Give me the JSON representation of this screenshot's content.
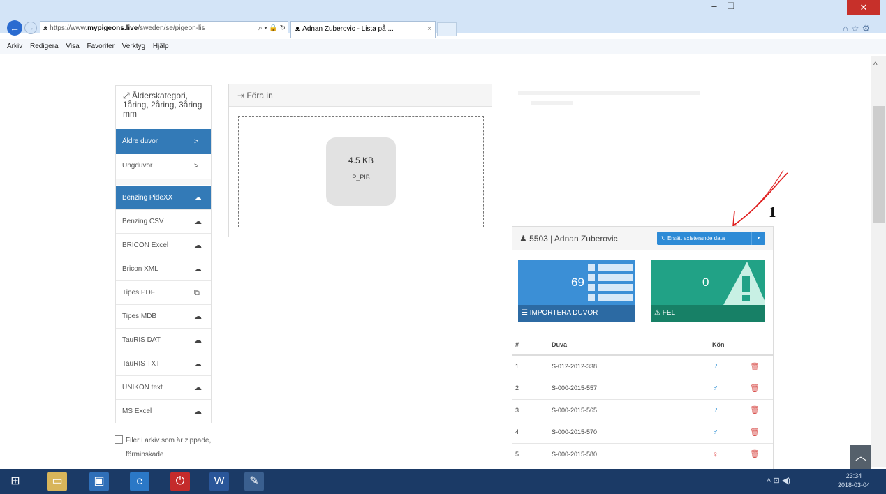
{
  "browser": {
    "url": "https://www.mypigeons.live/sweden/se/pigeon-lis",
    "url_prefix": "https://www.",
    "url_host": "mypigeons.live",
    "url_path": "/sweden/se/pigeon-lis",
    "tab_title": "Adnan Zuberovic - Lista på ...",
    "menu": [
      "Arkiv",
      "Redigera",
      "Visa",
      "Favoriter",
      "Verktyg",
      "Hjälp"
    ]
  },
  "left_menu": {
    "category_header": "Ålderskategori, 1åring, 2åring, 3åring mm",
    "age_items": [
      {
        "label": "Äldre duvor",
        "active": true,
        "icon": "chevron-right-icon"
      },
      {
        "label": "Ungduvor",
        "active": false,
        "icon": "chevron-right-icon"
      }
    ],
    "format_items": [
      {
        "label": "Benzing PideXX",
        "active": true,
        "icon": "cloud-upload-icon"
      },
      {
        "label": "Benzing CSV",
        "active": false,
        "icon": "cloud-upload-icon"
      },
      {
        "label": "BRICON Excel",
        "active": false,
        "icon": "cloud-upload-icon"
      },
      {
        "label": "Bricon XML",
        "active": false,
        "icon": "cloud-upload-icon"
      },
      {
        "label": "Tipes PDF",
        "active": false,
        "icon": "copy-icon"
      },
      {
        "label": "Tipes MDB",
        "active": false,
        "icon": "cloud-upload-icon"
      },
      {
        "label": "TauRIS DAT",
        "active": false,
        "icon": "cloud-upload-icon"
      },
      {
        "label": "TauRIS TXT",
        "active": false,
        "icon": "cloud-upload-icon"
      },
      {
        "label": "UNIKON text",
        "active": false,
        "icon": "cloud-upload-icon"
      },
      {
        "label": "MS Excel",
        "active": false,
        "icon": "cloud-upload-icon"
      }
    ],
    "archive_checkbox_label": "Filer i arkiv som är zippade, förminskade"
  },
  "upload": {
    "header": "Föra in",
    "file_size": "4.5 KB",
    "file_name": "P_PIB"
  },
  "annotation": {
    "number": "1"
  },
  "result": {
    "user_label": "5503 | Adnan Zuberovic",
    "replace_button": "Ersätt existerande data",
    "import_count": "69",
    "import_label": "IMPORTERA DUVOR",
    "error_count": "0",
    "error_label": "FEL",
    "table": {
      "headers": [
        "#",
        "Duva",
        "Kön"
      ],
      "rows": [
        {
          "n": "1",
          "duva": "S-012-2012-338",
          "kon": "♂",
          "sex": "male"
        },
        {
          "n": "2",
          "duva": "S-000-2015-557",
          "kon": "♂",
          "sex": "male"
        },
        {
          "n": "3",
          "duva": "S-000-2015-565",
          "kon": "♂",
          "sex": "male"
        },
        {
          "n": "4",
          "duva": "S-000-2015-570",
          "kon": "♂",
          "sex": "male"
        },
        {
          "n": "5",
          "duva": "S-000-2015-580",
          "kon": "♀",
          "sex": "female"
        }
      ]
    }
  },
  "taskbar": {
    "time": "23:34",
    "date": "2018-03-04"
  },
  "colors": {
    "primary": "#337ab7",
    "import_tile": "#3b8fd6",
    "error_tile": "#21a286",
    "delete": "#d9534f",
    "annotation_arrow": "#e02020"
  }
}
